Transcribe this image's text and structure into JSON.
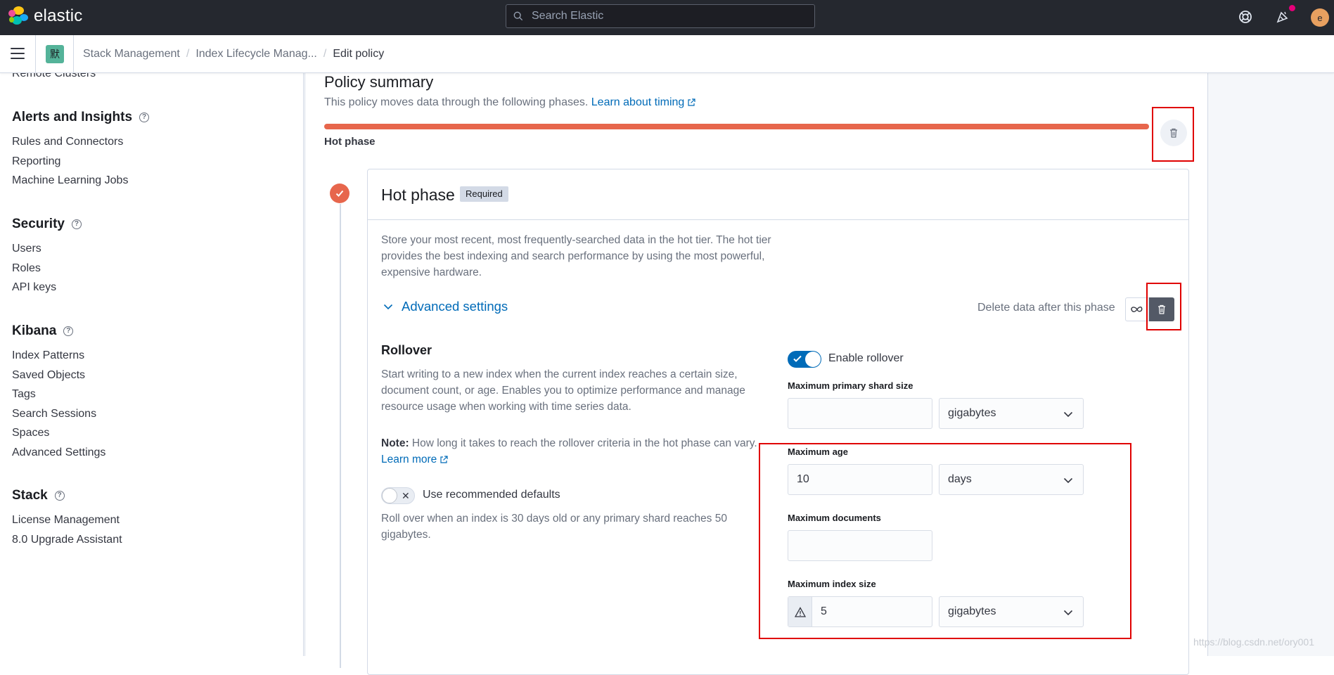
{
  "header": {
    "brand": "elastic",
    "search_placeholder": "Search Elastic",
    "avatar_initial": "e",
    "icons": [
      "help-icon",
      "newsfeed-icon"
    ]
  },
  "breadcrumbs": {
    "space_initial": "默",
    "items": [
      "Stack Management",
      "Index Lifecycle Manag...",
      "Edit policy"
    ]
  },
  "sidebar": {
    "cut_item": "Remote Clusters",
    "groups": [
      {
        "title": "Alerts and Insights",
        "items": [
          "Rules and Connectors",
          "Reporting",
          "Machine Learning Jobs"
        ]
      },
      {
        "title": "Security",
        "items": [
          "Users",
          "Roles",
          "API keys"
        ]
      },
      {
        "title": "Kibana",
        "items": [
          "Index Patterns",
          "Saved Objects",
          "Tags",
          "Search Sessions",
          "Spaces",
          "Advanced Settings"
        ]
      },
      {
        "title": "Stack",
        "items": [
          "License Management",
          "8.0 Upgrade Assistant"
        ]
      }
    ]
  },
  "summary": {
    "title": "Policy summary",
    "desc": "This policy moves data through the following phases.",
    "link": "Learn about timing",
    "phase_label": "Hot phase"
  },
  "hot_phase": {
    "title": "Hot phase",
    "badge": "Required",
    "description": "Store your most recent, most frequently-searched data in the hot tier. The hot tier provides the best indexing and search performance by using the most powerful, expensive hardware.",
    "advanced_settings": "Advanced settings",
    "delete_label": "Delete data after this phase",
    "rollover": {
      "title": "Rollover",
      "desc": "Start writing to a new index when the current index reaches a certain size, document count, or age. Enables you to optimize performance and manage resource usage when working with time series data.",
      "note_label": "Note:",
      "note_text": "How long it takes to reach the rollover criteria in the hot phase can vary.",
      "note_link": "Learn more",
      "recommended_label": "Use recommended defaults",
      "recommended_desc": "Roll over when an index is 30 days old or any primary shard reaches 50 gigabytes.",
      "enable_label": "Enable rollover",
      "enabled": true,
      "fields": {
        "max_primary_shard_size": {
          "label": "Maximum primary shard size",
          "value": "",
          "unit": "gigabytes"
        },
        "max_age": {
          "label": "Maximum age",
          "value": "10",
          "unit": "days"
        },
        "max_docs": {
          "label": "Maximum documents",
          "value": ""
        },
        "max_index_size": {
          "label": "Maximum index size",
          "value": "5",
          "unit": "gigabytes"
        }
      }
    }
  },
  "watermark": "https://blog.csdn.net/ory001",
  "colors": {
    "hot": "#e7664c",
    "link": "#006bb8",
    "highlight": "#e00000",
    "header_bg": "#25282f"
  }
}
